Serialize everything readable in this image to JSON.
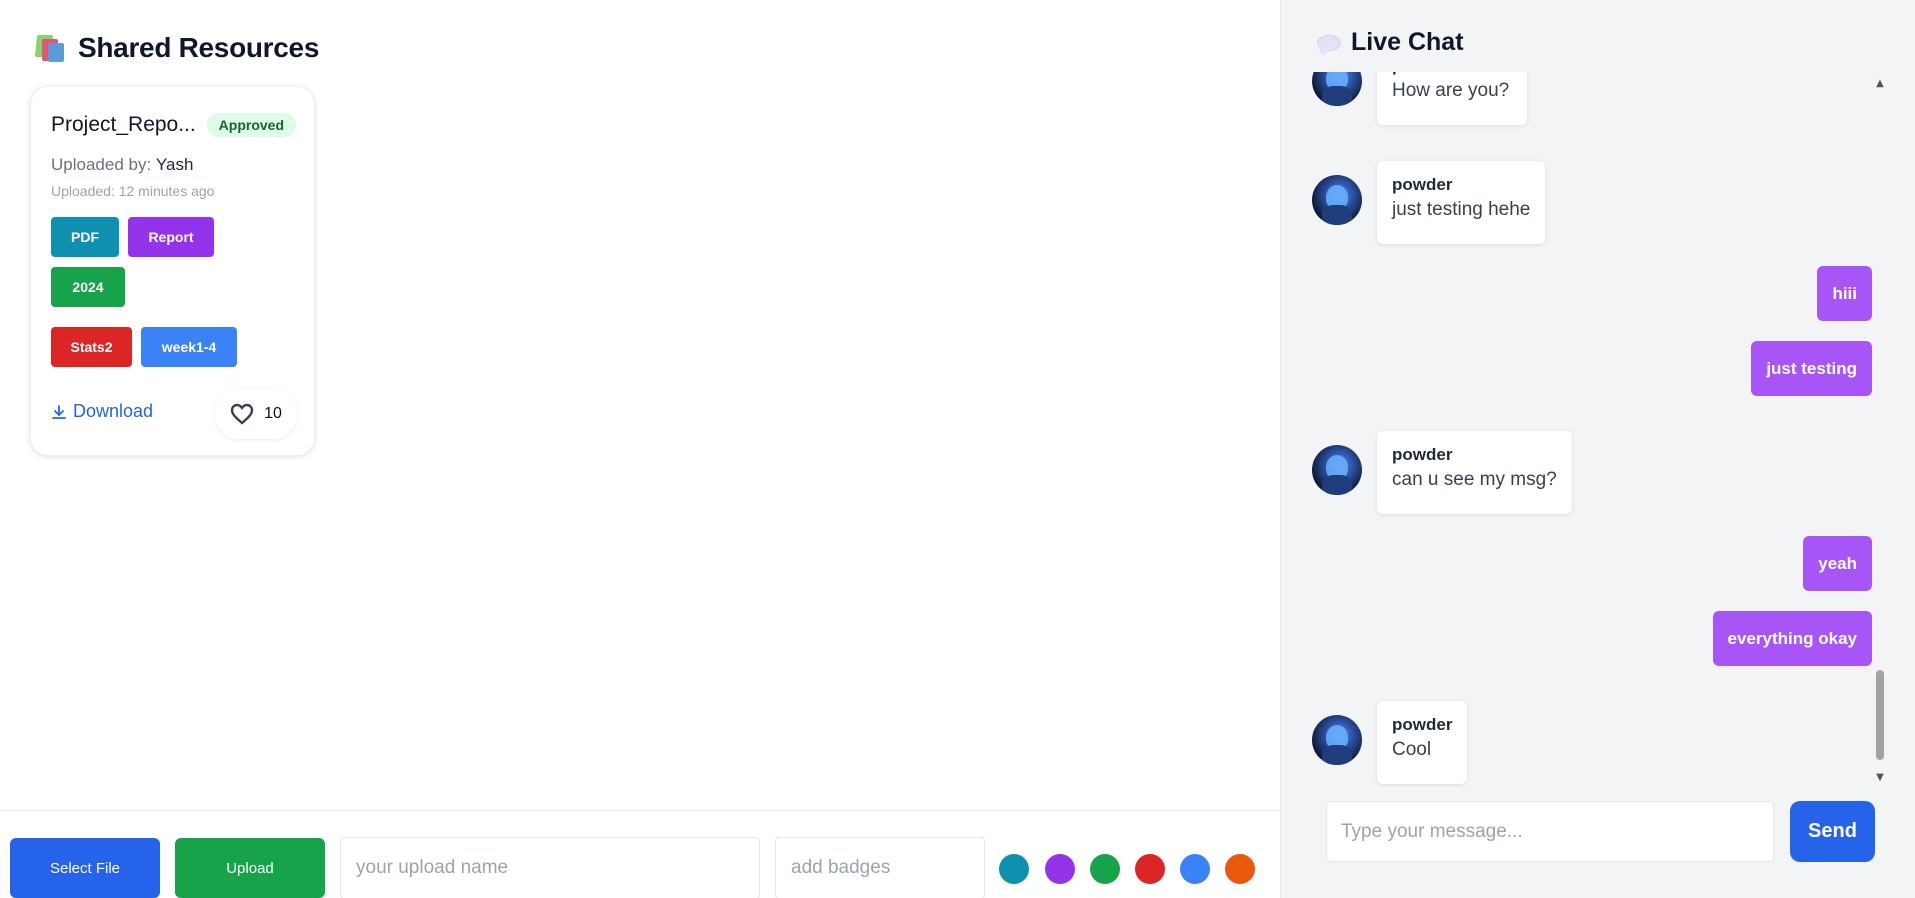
{
  "resources": {
    "title": "Shared Resources",
    "icon": "books-icon",
    "cards": [
      {
        "file_name": "Project_Repo...",
        "status": "Approved",
        "uploaded_by_label": "Uploaded by:",
        "uploaded_by": "Yash",
        "uploaded_time": "Uploaded: 12 minutes ago",
        "badges": [
          {
            "label": "PDF",
            "color": "#0e91b1"
          },
          {
            "label": "Report",
            "color": "#9333ea"
          },
          {
            "label": "2024",
            "color": "#16a34a"
          },
          {
            "label": "Stats2",
            "color": "#dc2626"
          },
          {
            "label": "week1-4",
            "color": "#3b82f6"
          }
        ],
        "download_label": "Download",
        "likes": "10"
      }
    ]
  },
  "upload_bar": {
    "select_file_label": "Select File",
    "upload_label": "Upload",
    "name_placeholder": "your upload name",
    "badges_placeholder": "add badges",
    "colors": [
      "#0e91b1",
      "#9333ea",
      "#16a34a",
      "#dc2626",
      "#3b82f6",
      "#ea580c"
    ]
  },
  "chat": {
    "title": "Live Chat",
    "icon": "speech-bubble-icon",
    "messages": [
      {
        "type": "incoming",
        "name": "powder",
        "text": "How are you?"
      },
      {
        "type": "incoming",
        "name": "powder",
        "text": "just testing hehe"
      },
      {
        "type": "outgoing",
        "text": "hiii"
      },
      {
        "type": "outgoing",
        "text": "just testing"
      },
      {
        "type": "incoming",
        "name": "powder",
        "text": "can u see my msg?"
      },
      {
        "type": "outgoing",
        "text": "yeah"
      },
      {
        "type": "outgoing",
        "text": "everything okay"
      },
      {
        "type": "incoming",
        "name": "powder",
        "text": "Cool"
      }
    ],
    "input_placeholder": "Type your message...",
    "send_label": "Send"
  }
}
